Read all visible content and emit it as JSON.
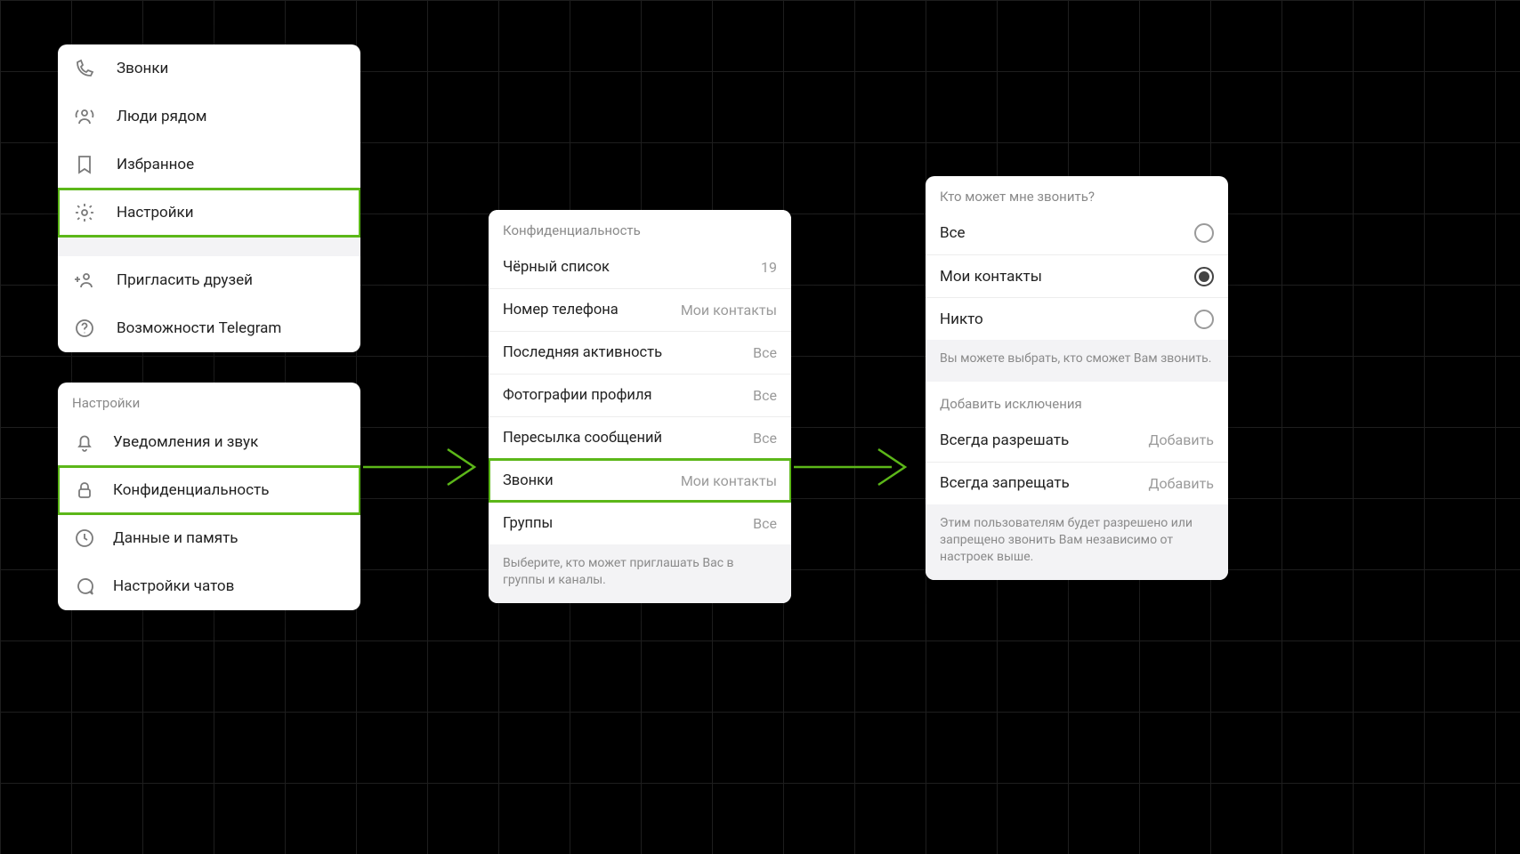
{
  "menu": {
    "items": [
      {
        "icon": "phone-icon",
        "label": "Звонки"
      },
      {
        "icon": "people-nearby-icon",
        "label": "Люди рядом"
      },
      {
        "icon": "bookmark-icon",
        "label": "Избранное"
      },
      {
        "icon": "gear-icon",
        "label": "Настройки"
      },
      {
        "icon": "invite-icon",
        "label": "Пригласить друзей"
      },
      {
        "icon": "help-icon",
        "label": "Возможности Telegram"
      }
    ]
  },
  "settings": {
    "header": "Настройки",
    "items": [
      {
        "icon": "bell-icon",
        "label": "Уведомления и звук"
      },
      {
        "icon": "lock-icon",
        "label": "Конфиденциальность"
      },
      {
        "icon": "data-icon",
        "label": "Данные и память"
      },
      {
        "icon": "chat-icon",
        "label": "Настройки чатов"
      }
    ]
  },
  "privacy": {
    "header": "Конфиденциальность",
    "items": [
      {
        "label": "Чёрный список",
        "value": "19"
      },
      {
        "label": "Номер телефона",
        "value": "Мои контакты"
      },
      {
        "label": "Последняя активность",
        "value": "Все"
      },
      {
        "label": "Фотографии профиля",
        "value": "Все"
      },
      {
        "label": "Пересылка сообщений",
        "value": "Все"
      },
      {
        "label": "Звонки",
        "value": "Мои контакты"
      },
      {
        "label": "Группы",
        "value": "Все"
      }
    ],
    "footer": "Выберите, кто может приглашать Вас в группы и каналы."
  },
  "calls": {
    "header": "Кто может мне звонить?",
    "options": [
      {
        "label": "Все",
        "selected": false
      },
      {
        "label": "Мои контакты",
        "selected": true
      },
      {
        "label": "Никто",
        "selected": false
      }
    ],
    "note1": "Вы можете выбрать, кто сможет Вам звонить.",
    "exceptions_header": "Добавить исключения",
    "exceptions": [
      {
        "label": "Всегда разрешать",
        "action": "Добавить"
      },
      {
        "label": "Всегда запрещать",
        "action": "Добавить"
      }
    ],
    "note2": "Этим пользователям будет разрешено или запрещено звонить Вам независимо от настроек выше."
  },
  "colors": {
    "accent": "#5cb719"
  }
}
